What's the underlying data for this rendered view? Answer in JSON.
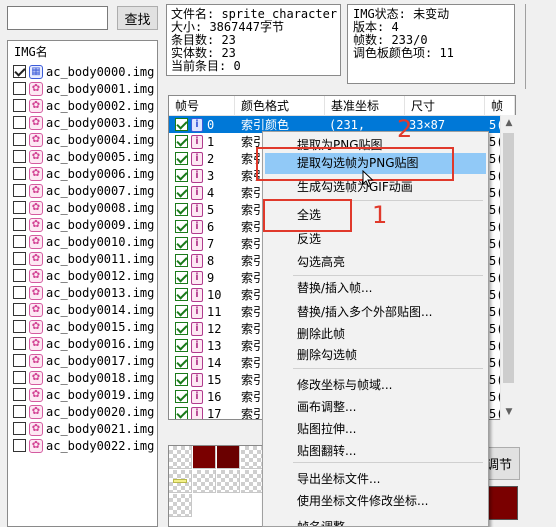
{
  "search": {
    "value": "",
    "button": "查找"
  },
  "img_list": {
    "header": "IMG名",
    "items": [
      {
        "name": "ac_body0000.img",
        "checked": true
      },
      {
        "name": "ac_body0001.img",
        "checked": false
      },
      {
        "name": "ac_body0002.img",
        "checked": false
      },
      {
        "name": "ac_body0003.img",
        "checked": false
      },
      {
        "name": "ac_body0004.img",
        "checked": false
      },
      {
        "name": "ac_body0005.img",
        "checked": false
      },
      {
        "name": "ac_body0006.img",
        "checked": false
      },
      {
        "name": "ac_body0007.img",
        "checked": false
      },
      {
        "name": "ac_body0008.img",
        "checked": false
      },
      {
        "name": "ac_body0009.img",
        "checked": false
      },
      {
        "name": "ac_body0010.img",
        "checked": false
      },
      {
        "name": "ac_body0011.img",
        "checked": false
      },
      {
        "name": "ac_body0012.img",
        "checked": false
      },
      {
        "name": "ac_body0013.img",
        "checked": false
      },
      {
        "name": "ac_body0014.img",
        "checked": false
      },
      {
        "name": "ac_body0015.img",
        "checked": false
      },
      {
        "name": "ac_body0016.img",
        "checked": false
      },
      {
        "name": "ac_body0017.img",
        "checked": false
      },
      {
        "name": "ac_body0018.img",
        "checked": false
      },
      {
        "name": "ac_body0019.img",
        "checked": false
      },
      {
        "name": "ac_body0020.img",
        "checked": false
      },
      {
        "name": "ac_body0021.img",
        "checked": false
      },
      {
        "name": "ac_body0022.img",
        "checked": false
      }
    ]
  },
  "file_info": {
    "lines": [
      "文件名: sprite_character",
      "大小: 3867447字节",
      "条目数: 23",
      "实体数: 23",
      "当前条目: 0"
    ]
  },
  "img_info": {
    "lines": [
      "IMG状态: 未变动",
      "版本: 4",
      "帧数: 233/0",
      "调色板颜色项: 11"
    ]
  },
  "frame_table": {
    "columns": [
      "帧号",
      "颜色格式",
      "基准坐标",
      "尺寸",
      "帧"
    ],
    "rows": [
      {
        "index": "0",
        "format": "索引颜色",
        "coord": "(231,",
        "size": "33×87",
        "tail": "5("
      },
      {
        "index": "1",
        "format": "索引",
        "coord": "",
        "size": "",
        "tail": "5("
      },
      {
        "index": "2",
        "format": "索引",
        "coord": "",
        "size": "",
        "tail": "5("
      },
      {
        "index": "3",
        "format": "索引",
        "coord": "",
        "size": "",
        "tail": "5("
      },
      {
        "index": "4",
        "format": "索引",
        "coord": "",
        "size": "",
        "tail": "5("
      },
      {
        "index": "5",
        "format": "索引",
        "coord": "",
        "size": "",
        "tail": "5("
      },
      {
        "index": "6",
        "format": "索引",
        "coord": "",
        "size": "",
        "tail": "5("
      },
      {
        "index": "7",
        "format": "索引",
        "coord": "",
        "size": "",
        "tail": "5("
      },
      {
        "index": "8",
        "format": "索引",
        "coord": "",
        "size": "",
        "tail": "5("
      },
      {
        "index": "9",
        "format": "索引",
        "coord": "",
        "size": "",
        "tail": "5("
      },
      {
        "index": "10",
        "format": "索引",
        "coord": "",
        "size": "",
        "tail": "5("
      },
      {
        "index": "11",
        "format": "索引",
        "coord": "",
        "size": "",
        "tail": "5("
      },
      {
        "index": "12",
        "format": "索引",
        "coord": "",
        "size": "",
        "tail": "5("
      },
      {
        "index": "13",
        "format": "索引",
        "coord": "",
        "size": "",
        "tail": "5("
      },
      {
        "index": "14",
        "format": "索引",
        "coord": "",
        "size": "",
        "tail": "5("
      },
      {
        "index": "15",
        "format": "索引",
        "coord": "",
        "size": "",
        "tail": "5("
      },
      {
        "index": "16",
        "format": "索引",
        "coord": "",
        "size": "",
        "tail": "5("
      },
      {
        "index": "17",
        "format": "索引",
        "coord": "",
        "size": "",
        "tail": "5("
      }
    ]
  },
  "adjust_button": "调节",
  "palette_colors": [
    "checker",
    "#7a0000",
    "#6a0000",
    "checker",
    "#e9e98a",
    "checker",
    "checker",
    "checker",
    "checker"
  ],
  "context_menu": {
    "items": [
      "提取为PNG贴图",
      "提取勾选帧为PNG贴图",
      "生成勾选帧为GIF动画",
      "全选",
      "反选",
      "勾选高亮",
      "替换/插入帧...",
      "替换/插入多个外部贴图...",
      "删除此帧",
      "删除勾选帧",
      "修改坐标与帧域...",
      "画布调整...",
      "贴图拉伸...",
      "贴图翻转...",
      "导出坐标文件...",
      "使用坐标文件修改坐标...",
      "帧名调整"
    ],
    "hover_index": 1
  },
  "annotations": {
    "label_1": "1",
    "label_2": "2"
  },
  "colors": {
    "accent": "#0078d7",
    "menu_hover": "#91c9f7",
    "annotation": "#e0392b",
    "img_icon": "#d24394"
  }
}
